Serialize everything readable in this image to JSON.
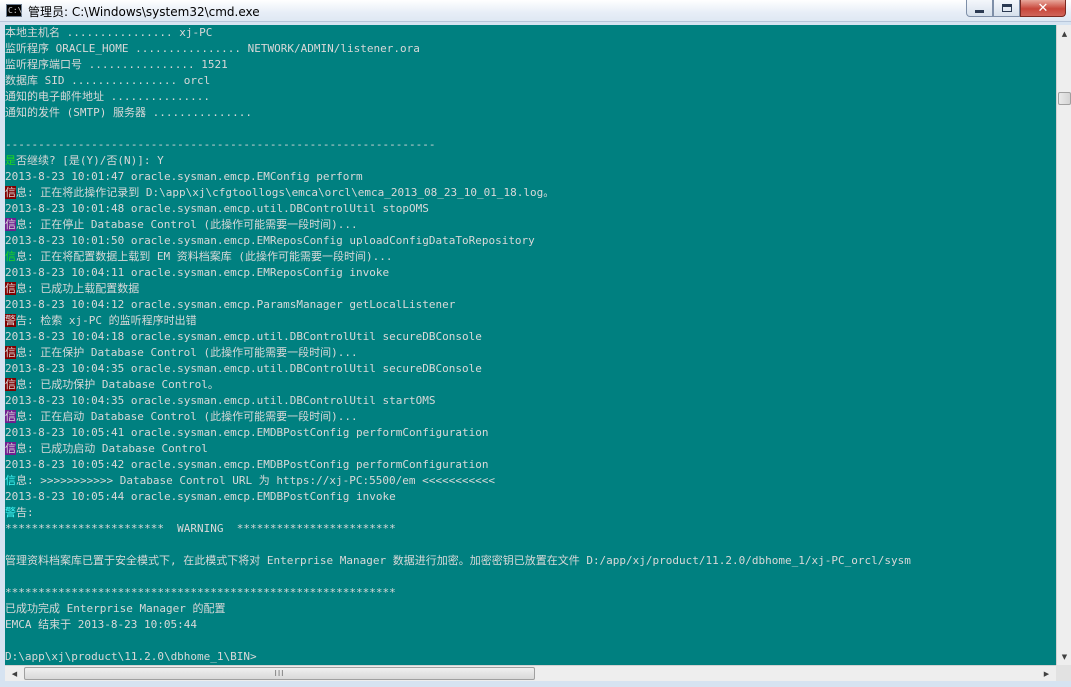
{
  "window": {
    "title": "管理员: C:\\Windows\\system32\\cmd.exe",
    "icon": "cmd-icon",
    "icon_text": "C:\\",
    "controls": {
      "minimize": "minimize-icon",
      "maximize": "maximize-icon",
      "close": "✕"
    }
  },
  "colors": {
    "console_bg": "#008080",
    "console_text": "#d8d8d8",
    "highlight_green": "#1fd81f",
    "highlight_red_bg": "#800000",
    "highlight_purple_bg": "#6f1f8f",
    "highlight_cyan": "#3ff5f5"
  },
  "console": {
    "lines": [
      {
        "text": "本地主机名 ................ xj-PC"
      },
      {
        "text": "监听程序 ORACLE_HOME ................ NETWORK/ADMIN/listener.ora"
      },
      {
        "text": "监听程序端口号 ................ 1521"
      },
      {
        "text": "数据库 SID ................ orcl"
      },
      {
        "text": "通知的电子邮件地址 ..............."
      },
      {
        "text": "通知的发件 (SMTP) 服务器 ..............."
      },
      {
        "text": ""
      },
      {
        "text": "-----------------------------------------------------------------"
      },
      {
        "hl": "是",
        "hl_style": "green",
        "text": "否继续? [是(Y)/否(N)]: Y"
      },
      {
        "text": "2013-8-23 10:01:47 oracle.sysman.emcp.EMConfig perform"
      },
      {
        "hl": "信",
        "hl_style": "red-bg",
        "text": "息: 正在将此操作记录到 D:\\app\\xj\\cfgtoollogs\\emca\\orcl\\emca_2013_08_23_10_01_18.log。"
      },
      {
        "text": "2013-8-23 10:01:48 oracle.sysman.emcp.util.DBControlUtil stopOMS"
      },
      {
        "hl": "信",
        "hl_style": "purple-bg",
        "text": "息: 正在停止 Database Control (此操作可能需要一段时间)..."
      },
      {
        "text": "2013-8-23 10:01:50 oracle.sysman.emcp.EMReposConfig uploadConfigDataToRepository"
      },
      {
        "hl": "信",
        "hl_style": "green",
        "text": "息: 正在将配置数据上载到 EM 资料档案库 (此操作可能需要一段时间)..."
      },
      {
        "text": "2013-8-23 10:04:11 oracle.sysman.emcp.EMReposConfig invoke"
      },
      {
        "hl": "信",
        "hl_style": "red-bg",
        "text": "息: 已成功上载配置数据"
      },
      {
        "text": "2013-8-23 10:04:12 oracle.sysman.emcp.ParamsManager getLocalListener"
      },
      {
        "hl": "警",
        "hl_style": "red-bg",
        "text": "告: 检索 xj-PC 的监听程序时出错"
      },
      {
        "text": "2013-8-23 10:04:18 oracle.sysman.emcp.util.DBControlUtil secureDBConsole"
      },
      {
        "hl": "信",
        "hl_style": "red-bg",
        "text": "息: 正在保护 Database Control (此操作可能需要一段时间)..."
      },
      {
        "text": "2013-8-23 10:04:35 oracle.sysman.emcp.util.DBControlUtil secureDBConsole"
      },
      {
        "hl": "信",
        "hl_style": "red-bg",
        "text": "息: 已成功保护 Database Control。"
      },
      {
        "text": "2013-8-23 10:04:35 oracle.sysman.emcp.util.DBControlUtil startOMS"
      },
      {
        "hl": "信",
        "hl_style": "purple-bg",
        "text": "息: 正在启动 Database Control (此操作可能需要一段时间)..."
      },
      {
        "text": "2013-8-23 10:05:41 oracle.sysman.emcp.EMDBPostConfig performConfiguration"
      },
      {
        "hl": "信",
        "hl_style": "purple-bg",
        "text": "息: 已成功启动 Database Control"
      },
      {
        "text": "2013-8-23 10:05:42 oracle.sysman.emcp.EMDBPostConfig performConfiguration"
      },
      {
        "hl": "信",
        "hl_style": "cyan",
        "text": "息: >>>>>>>>>>> Database Control URL 为 https://xj-PC:5500/em <<<<<<<<<<<"
      },
      {
        "text": "2013-8-23 10:05:44 oracle.sysman.emcp.EMDBPostConfig invoke"
      },
      {
        "hl": "警",
        "hl_style": "cyan",
        "text": "告:"
      },
      {
        "text": "************************  WARNING  ************************"
      },
      {
        "text": ""
      },
      {
        "text": "管理资料档案库已置于安全模式下, 在此模式下将对 Enterprise Manager 数据进行加密。加密密钥已放置在文件 D:/app/xj/product/11.2.0/dbhome_1/xj-PC_orcl/sysm"
      },
      {
        "text": ""
      },
      {
        "text": "***********************************************************"
      },
      {
        "text": "已成功完成 Enterprise Manager 的配置"
      },
      {
        "text": "EMCA 结束于 2013-8-23 10:05:44"
      },
      {
        "text": ""
      },
      {
        "text": "D:\\app\\xj\\product\\11.2.0\\dbhome_1\\BIN>"
      }
    ]
  },
  "scrollbars": {
    "vertical": {
      "up": "▲",
      "down": "▼"
    },
    "horizontal": {
      "left": "◀",
      "right": "▶",
      "grip": "III"
    }
  }
}
